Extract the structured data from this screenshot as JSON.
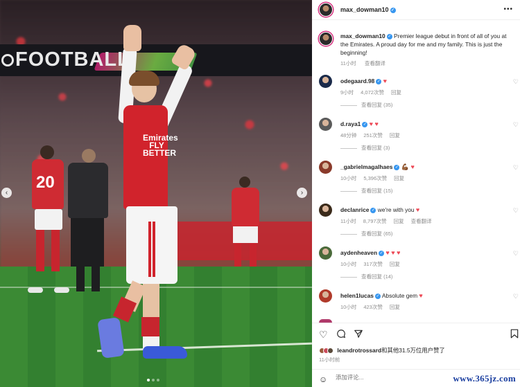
{
  "post": {
    "author": "max_dowman10",
    "caption": "Premier league debut in front of all of you at the Emirates. A proud day for me and my family. This is just the beginning!",
    "caption_time": "11小时",
    "translate_label": "查看翻译",
    "board_text": "FOOTBALL",
    "shirt_sponsor": "Emirates FLY BETTER",
    "number_bg": "20"
  },
  "comments": [
    {
      "user": "odegaard.98",
      "text": "",
      "hearts": "♥",
      "time": "9小时",
      "likes": "4,072次赞",
      "reply": "回复",
      "view_replies": "查看回复 (35)",
      "avatar_color": "#1a2a4a"
    },
    {
      "user": "d.raya1",
      "text": "",
      "hearts": "♥ ♥",
      "time": "48分钟",
      "likes": "251次赞",
      "reply": "回复",
      "view_replies": "查看回复 (3)",
      "avatar_color": "#5a5a5a"
    },
    {
      "user": "_gabrielmagalhaes",
      "text": "",
      "hearts": "💪🏾 ♥",
      "time": "10小时",
      "likes": "5,396次赞",
      "reply": "回复",
      "view_replies": "查看回复 (15)",
      "avatar_color": "#8a3a2a"
    },
    {
      "user": "declanrice",
      "text": "we're with you",
      "hearts": "♥",
      "time": "11小时",
      "likes": "8,797次赞",
      "reply": "回复",
      "translate": "查看翻译",
      "view_replies": "查看回复 (65)",
      "avatar_color": "#3a2a1a"
    },
    {
      "user": "aydenheaven",
      "text": "",
      "hearts": "♥ ♥ ♥",
      "time": "10小时",
      "likes": "317次赞",
      "reply": "回复",
      "view_replies": "查看回复 (14)",
      "avatar_color": "#4a6a3a"
    },
    {
      "user": "helen1lucas",
      "text": "Absolute gem",
      "hearts": "♥",
      "time": "10小时",
      "likes": "423次赞",
      "reply": "回复",
      "view_replies": "",
      "avatar_color": "#b03a2a"
    }
  ],
  "likes_line": {
    "user": "leandrotrossard",
    "text": "和其他31.5万位用户赞了"
  },
  "post_time": "11小时前",
  "comment_placeholder": "添加评论...",
  "watermark": "www.365jz.com",
  "colors": {
    "verified": "#3897f0",
    "heart": "#ed4956",
    "story_ring": "#d4287a"
  }
}
